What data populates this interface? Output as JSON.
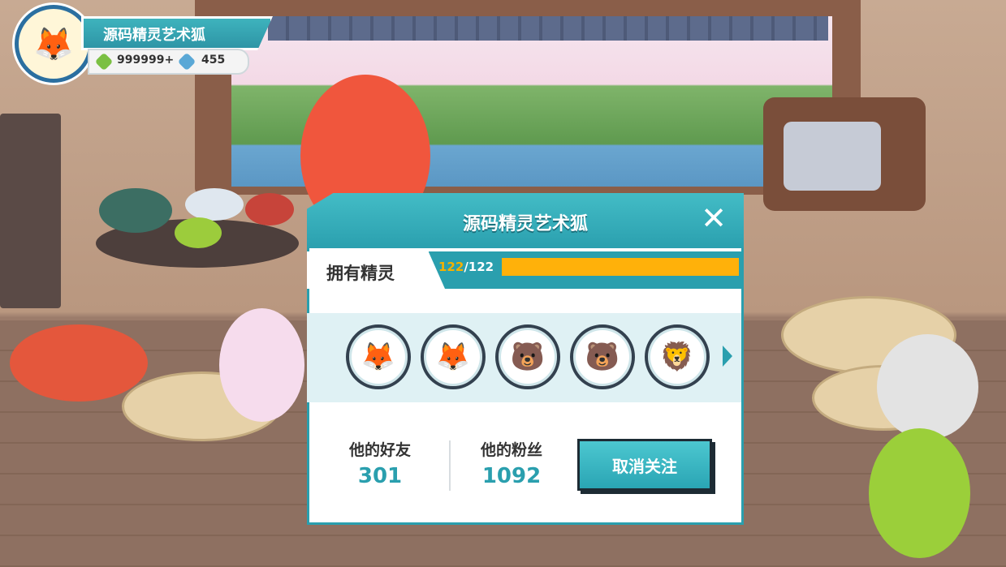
{
  "player": {
    "name": "源码精灵艺术狐",
    "green_gems": "999999+",
    "blue_gems": "455",
    "avatar_icon": "fox-avatar-icon"
  },
  "panel": {
    "title": "源码精灵艺术狐",
    "close_glyph": "✕",
    "tab_label": "拥有精灵",
    "owned_count": "122",
    "owned_total": "/122",
    "owned_progress": 1.0,
    "sprites": [
      {
        "name": "red-fox-sprite",
        "glyph": "🦊"
      },
      {
        "name": "masked-fox-sprite",
        "glyph": "🦊"
      },
      {
        "name": "bear-cub-sprite",
        "glyph": "🐻"
      },
      {
        "name": "fire-bear-sprite",
        "glyph": "🐻"
      },
      {
        "name": "flame-lion-sprite",
        "glyph": "🦁"
      }
    ],
    "friends_label": "他的好友",
    "friends_value": "301",
    "fans_label": "他的粉丝",
    "fans_value": "1092",
    "unfollow_label": "取消关注"
  },
  "colors": {
    "accent": "#2a9fae",
    "progress": "#ffb10a"
  }
}
